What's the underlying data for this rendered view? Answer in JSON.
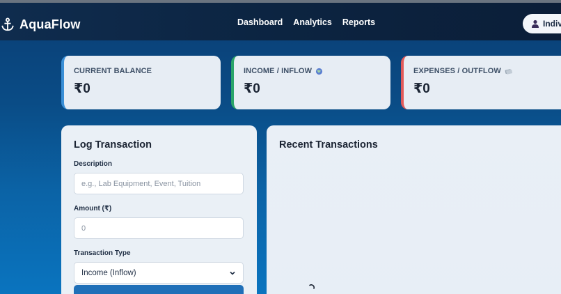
{
  "brand": {
    "name": "AquaFlow",
    "icon": "anchor-icon"
  },
  "nav": {
    "items": [
      "Dashboard",
      "Analytics",
      "Reports"
    ]
  },
  "user": {
    "label": "Indiv",
    "icon": "user-icon"
  },
  "stats": {
    "balance": {
      "label": "CURRENT BALANCE",
      "value": "₹0"
    },
    "income": {
      "label": "INCOME / INFLOW",
      "value": "₹0",
      "icon": "globe-icon"
    },
    "expense": {
      "label": "EXPENSES / OUTFLOW",
      "value": "₹0",
      "icon": "money-icon"
    }
  },
  "log": {
    "title": "Log Transaction",
    "description_label": "Description",
    "description_placeholder": "e.g., Lab Equipment, Event, Tuition",
    "amount_label": "Amount (₹)",
    "amount_placeholder": "0",
    "type_label": "Transaction Type",
    "type_selected": "Income (Inflow)"
  },
  "recent": {
    "title": "Recent Transactions"
  },
  "colors": {
    "balance_accent": "#3a8fd6",
    "income_accent": "#2aa56a",
    "expense_accent": "#e25a5a",
    "primary": "#1f6fb8"
  }
}
